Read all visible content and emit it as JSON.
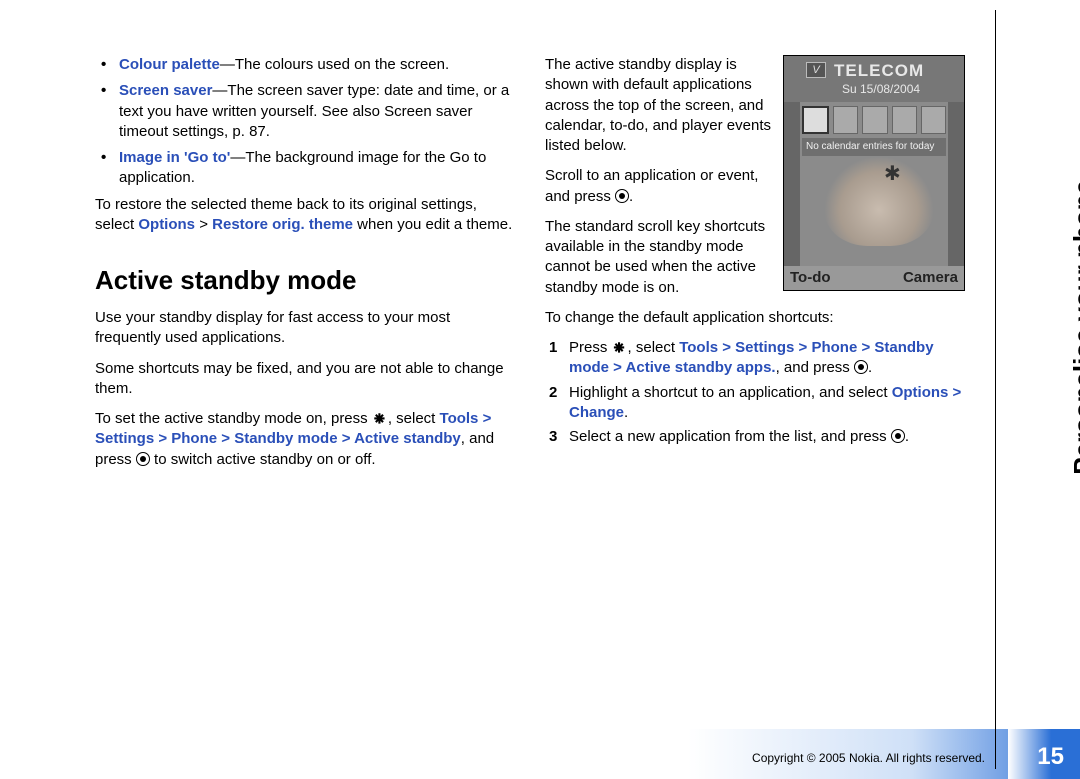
{
  "bullets": [
    {
      "term": "Colour palette",
      "rest": "—The colours used on the screen."
    },
    {
      "term": "Screen saver",
      "rest": "—The screen saver type: date and time, or a text you have written yourself. See also Screen saver timeout settings, p. 87."
    },
    {
      "term": "Image in 'Go to'",
      "rest": "—The background image for the Go to application."
    }
  ],
  "restore": {
    "p1a": "To restore the selected theme back to its original settings, select ",
    "opt": "Options",
    "gt1": " > ",
    "rest": "Restore orig. theme",
    "p1b": " when you edit a theme."
  },
  "heading": "Active standby mode",
  "para1": "Use your standby display for fast access to your most frequently used applications.",
  "para2": "Some shortcuts may be fixed, and you are not able to change them.",
  "set": {
    "a": "To set the active standby mode on, press ",
    "b": ", select ",
    "path": "Tools > Settings > Phone > Standby mode > Active standby",
    "c": ", and press ",
    "d": " to switch active standby on or off."
  },
  "col2p1": "The active standby display is shown with default applications across the top of the screen, and calendar, to-do, and player events listed below.",
  "col2p2a": "Scroll to an application or event, and press ",
  "col2p2b": ".",
  "col2p3": "The standard scroll key shortcuts available in the standby mode cannot be used when the active standby mode is on.",
  "col2p4": "To change the default application shortcuts:",
  "steps": {
    "s1a": "Press ",
    "s1b": ", select ",
    "s1path": "Tools > Settings > Phone > Standby mode > Active standby apps.",
    "s1c": ", and press ",
    "s1d": ".",
    "s2a": "Highlight a shortcut to an application, and select ",
    "s2path": "Options > Change",
    "s2b": ".",
    "s3a": "Select a new application from the list, and press ",
    "s3b": "."
  },
  "shot": {
    "operator": "TELECOM",
    "date": "Su 15/08/2004",
    "cal": "No calendar entries for today",
    "left": "To-do",
    "right": "Camera",
    "vlabel": "V"
  },
  "side": "Personalise your phone",
  "pagenum": "15",
  "copyright": "Copyright © 2005 Nokia. All rights reserved."
}
